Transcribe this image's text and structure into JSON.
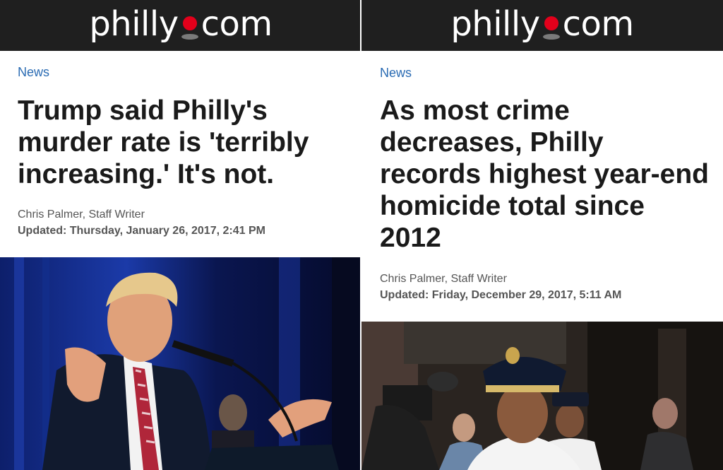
{
  "left": {
    "logo": "philly com",
    "section": "News",
    "headline": "Trump said Philly's murder rate is 'terribly increasing.' It's not.",
    "byline": "Chris Palmer, Staff Writer",
    "updated": "Updated: Thursday, January 26, 2017, 2:41 PM",
    "photo_icon": "photo-speaker-at-podium"
  },
  "right": {
    "logo": "philly com",
    "section": "News",
    "headline": "As most crime decreases, Philly records highest year-end homicide total since 2012",
    "byline": "Chris Palmer, Staff Writer",
    "updated": "Updated: Friday, December 29, 2017, 5:11 AM",
    "photo_icon": "photo-police-commissioner"
  },
  "colors": {
    "masthead": "#1f1f1f",
    "logo_dot": "#e3001b",
    "section_link": "#2a6bb3",
    "headline": "#1a1a1a"
  }
}
